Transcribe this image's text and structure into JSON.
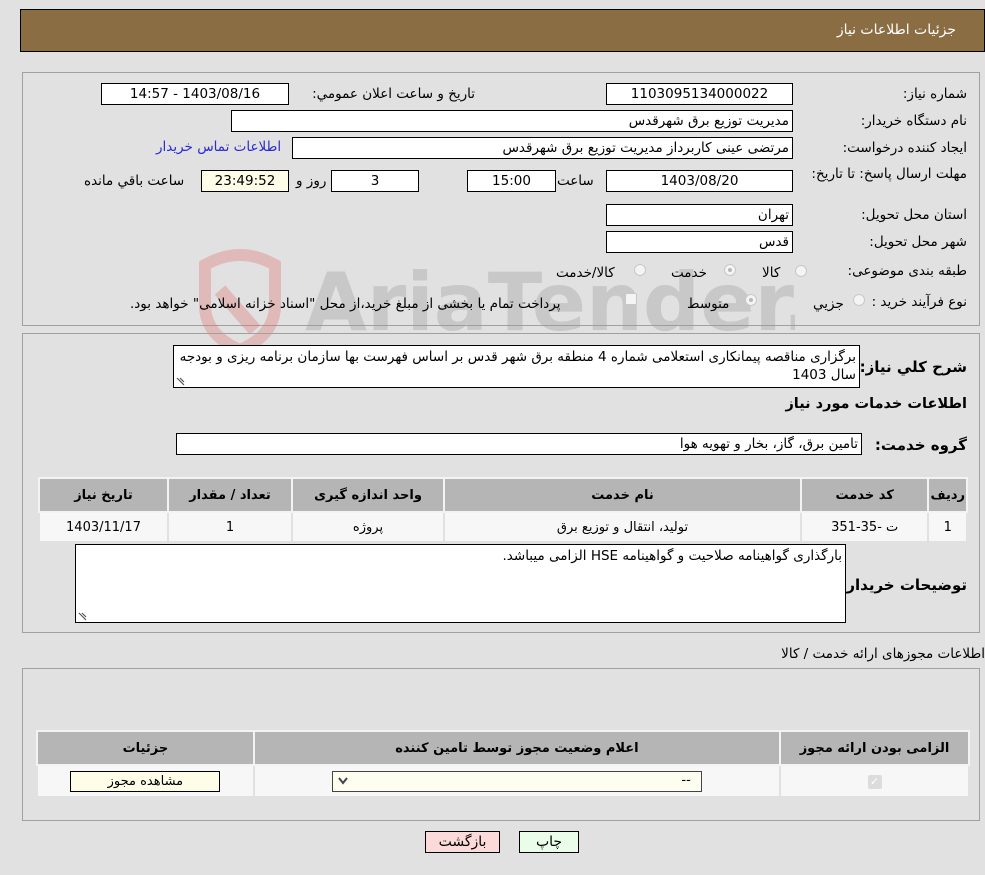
{
  "header": {
    "title": "جزئیات اطلاعات نیاز"
  },
  "form": {
    "need_number_label": "شماره نیاز:",
    "need_number": "1103095134000022",
    "announce_label": "تاريخ و ساعت اعلان عمومي:",
    "announce_value": "1403/08/16 - 14:57",
    "buyer_org_label": "نام دستگاه خریدار:",
    "buyer_org": "مدیریت توزیع برق شهرقدس",
    "creator_label": "ایجاد کننده درخواست:",
    "creator": "مرتضی عینی کاربرداز مدیریت توزیع برق شهرقدس",
    "contact_link": "اطلاعات تماس خریدار",
    "deadline_label": "مهلت ارسال پاسخ: تا تاریخ:",
    "deadline_date": "1403/08/20",
    "time_label": "ساعت",
    "deadline_time": "15:00",
    "days_value": "3",
    "days_label": "روز و",
    "remaining_value": "23:49:52",
    "remaining_label": "ساعت باقي مانده",
    "province_label": "استان محل تحویل:",
    "province": "تهران",
    "city_label": "شهر محل تحویل:",
    "city": "قدس",
    "category_label": "طبقه بندی موضوعی:",
    "category_options": [
      {
        "label": "کالا",
        "checked": false
      },
      {
        "label": "خدمت",
        "checked": true
      },
      {
        "label": "کالا/خدمت",
        "checked": false
      }
    ],
    "process_label": "نوع فرآیند خرید :",
    "process_options": [
      {
        "label": "جزيي",
        "checked": false
      },
      {
        "label": "متوسط",
        "checked": true
      }
    ],
    "treasury_note": "پرداخت تمام یا بخشی از مبلغ خرید،از محل \"اسناد خزانه اسلامی\" خواهد بود.",
    "treasury_checked": false
  },
  "description": {
    "label": "شرح کلي نياز:",
    "text": "برگزاری مناقصه پیمانکاری استعلامی شماره 4 منطقه برق شهر قدس بر اساس فهرست بها سازمان برنامه ریزی و بودجه سال 1403"
  },
  "services": {
    "section_title": "اطلاعات خدمات مورد نیاز",
    "group_label": "گروه خدمت:",
    "group_value": "تامین برق، گاز، بخار و تهویه هوا",
    "columns": [
      "ردیف",
      "کد خدمت",
      "نام خدمت",
      "واحد اندازه گیری",
      "تعداد / مقدار",
      "تاریخ نیاز"
    ],
    "rows": [
      [
        "1",
        "ت -35-351",
        "تولید، انتقال و توزیع برق",
        "پروژه",
        "1",
        "1403/11/17"
      ]
    ]
  },
  "buyer_notes": {
    "label": "توضیحات خریدار:",
    "text": "بارگذاری گواهینامه صلاحیت و  گواهینامه HSE   الزامی میباشد."
  },
  "permits": {
    "section_title": "اطلاعات مجوزهای ارائه خدمت / کالا",
    "columns": [
      "الزامی بودن ارائه مجوز",
      "اعلام وضعیت مجوز توسط تامین کننده",
      "جزئیات"
    ],
    "rows": [
      {
        "required_checked": true,
        "status_value": "--",
        "details_button": "مشاهده مجوز"
      }
    ]
  },
  "footer": {
    "print_button": "چاپ",
    "back_button": "بازگشت",
    "print_bg": "#eafde8",
    "back_bg": "#fddada"
  },
  "watermark": {
    "text": "AriaTender.neT"
  }
}
